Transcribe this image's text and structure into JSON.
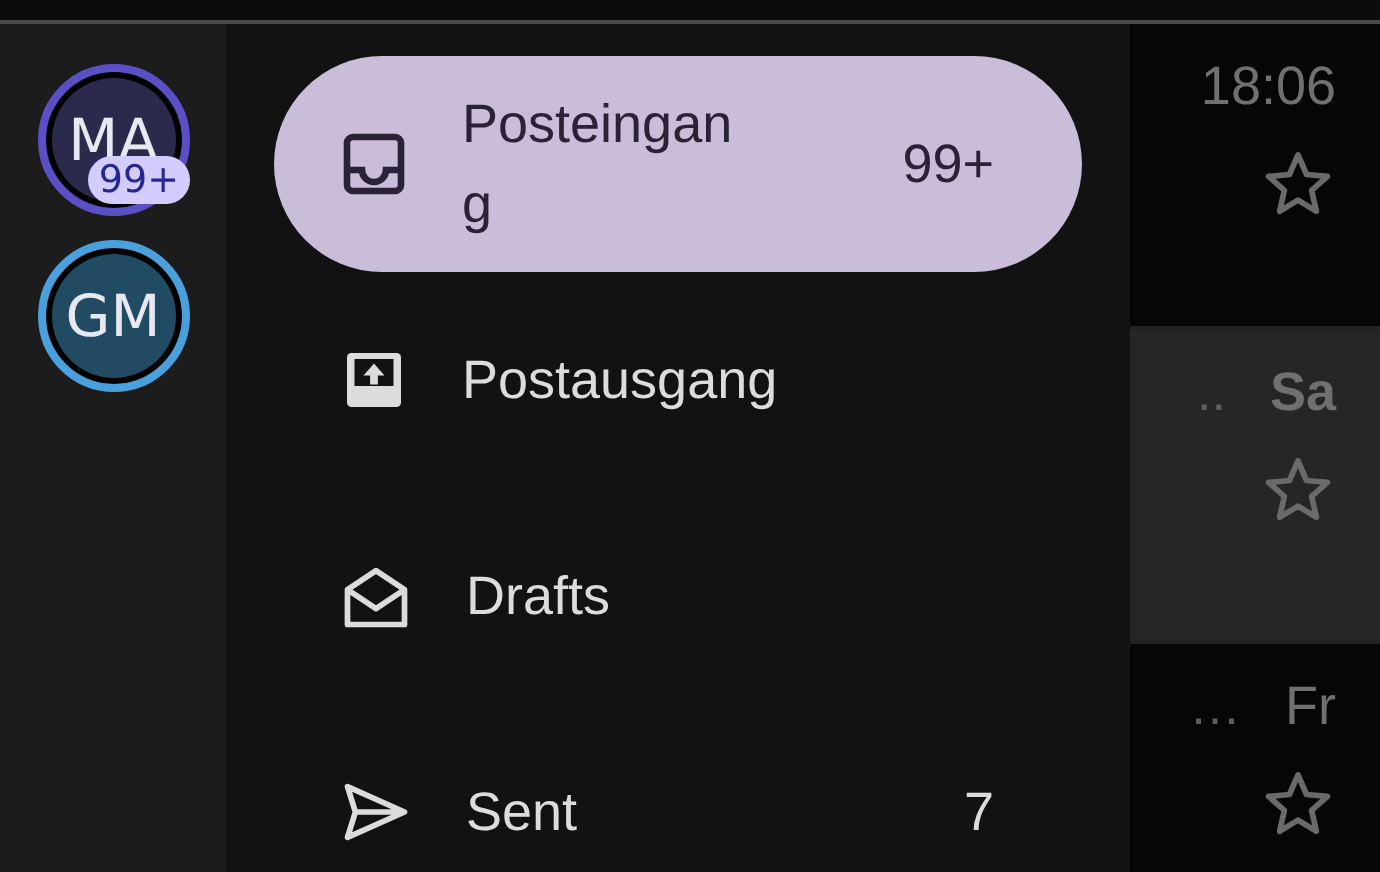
{
  "accounts": [
    {
      "initials": "MA",
      "badge": "99+",
      "color": "#5a4fc4",
      "selected": true
    },
    {
      "initials": "GM",
      "color": "#4aa0dc",
      "selected": false
    }
  ],
  "folders": [
    {
      "kind": "inbox",
      "label": "Posteingang",
      "count": "99+",
      "selected": true
    },
    {
      "kind": "outbox",
      "label": "Postausgang",
      "selected": false
    },
    {
      "kind": "drafts",
      "label": "Drafts",
      "selected": false
    },
    {
      "kind": "sent",
      "label": "Sent",
      "count": "7",
      "selected": false
    }
  ],
  "messages": [
    {
      "date": "18:06",
      "selected": false
    },
    {
      "snippet": "..",
      "date": "Sa",
      "selected": true
    },
    {
      "snippet": "…",
      "date": "Fr",
      "selected": false
    }
  ]
}
